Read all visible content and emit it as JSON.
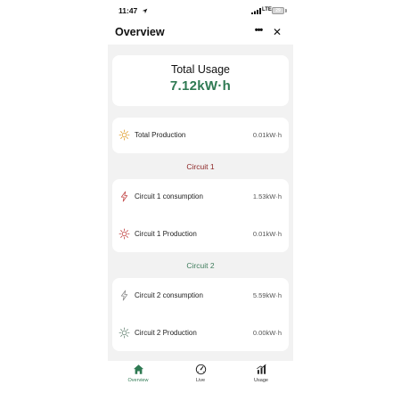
{
  "status_bar": {
    "time": "11:47",
    "network": "LTE",
    "battery": "29"
  },
  "header": {
    "title": "Overview",
    "more_label": "•••",
    "close_label": "✕"
  },
  "total": {
    "label": "Total Usage",
    "value": "7.12kW·h"
  },
  "production": {
    "label": "Total Production",
    "value": "0.01kW·h",
    "icon": "sun-icon"
  },
  "circuit1": {
    "title": "Circuit 1",
    "rows": [
      {
        "label": "Circuit 1 consumption",
        "value": "1.53kW·h",
        "icon": "lightning-icon"
      },
      {
        "label": "Circuit 1 Production",
        "value": "0.01kW·h",
        "icon": "sun-icon"
      }
    ]
  },
  "circuit2": {
    "title": "Circuit 2",
    "rows": [
      {
        "label": "Circuit 2 consumption",
        "value": "5.59kW·h",
        "icon": "lightning-icon"
      },
      {
        "label": "Circuit 2 Production",
        "value": "0.00kW·h",
        "icon": "sun-icon"
      }
    ]
  },
  "tabs": [
    {
      "label": "Overview",
      "icon": "home-icon",
      "active": true
    },
    {
      "label": "Live",
      "icon": "gauge-icon",
      "active": false
    },
    {
      "label": "Usage",
      "icon": "bar-chart-icon",
      "active": false
    }
  ],
  "colors": {
    "accent_green": "#2f7a53",
    "circuit1_red": "#8d2626",
    "circuit2_green": "#3e7c5b",
    "sun_orange": "#e0a030",
    "circuit1_icon": "#c24747",
    "circuit2_icon": "#8a8a8a",
    "background": "#f2f2f2"
  }
}
